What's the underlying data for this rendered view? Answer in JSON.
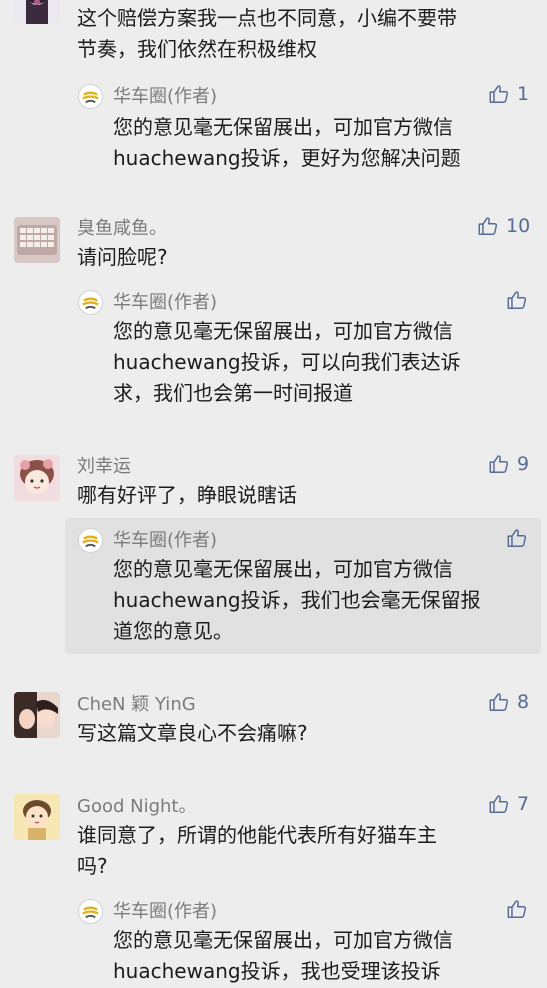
{
  "comments": [
    {
      "text_lines": [
        "这个赔偿方案我一点也不同意，小编不要带",
        "节奏，我们依然在积极维权"
      ],
      "reply": {
        "author": "华车圈(作者)",
        "likes": "1",
        "text_lines": [
          "您的意见毫无保留展出，可加官方微信",
          "huachewang投诉，更好为您解决问题"
        ]
      }
    },
    {
      "name": "臭鱼咸鱼。",
      "likes": "10",
      "text_lines": [
        "请问脸呢?"
      ],
      "reply": {
        "author": "华车圈(作者)",
        "text_lines": [
          "您的意见毫无保留展出，可加官方微信",
          "huachewang投诉，可以向我们表达诉",
          "求，我们也会第一时间报道"
        ]
      }
    },
    {
      "name": "刘幸运",
      "likes": "9",
      "text_lines": [
        "哪有好评了，睁眼说瞎话"
      ],
      "reply": {
        "author": "华车圈(作者)",
        "text_lines": [
          "您的意见毫无保留展出，可加官方微信",
          "huachewang投诉，我们也会毫无保留报",
          "道您的意见。"
        ]
      }
    },
    {
      "name": "CheN 颖 YinG",
      "likes": "8",
      "text_lines": [
        "写这篇文章良心不会痛嘛?"
      ]
    },
    {
      "name": "Good Night。",
      "likes": "7",
      "text_lines": [
        "谁同意了，所谓的他能代表所有好猫车主",
        "吗?"
      ],
      "reply": {
        "author": "华车圈(作者)",
        "text_lines": [
          "您的意见毫无保留展出，可加官方微信",
          "huachewang投诉，我也受理该投诉"
        ]
      }
    }
  ],
  "colors": {
    "like": "#576b95",
    "name": "#7b7b7b",
    "background": "#ededed"
  }
}
